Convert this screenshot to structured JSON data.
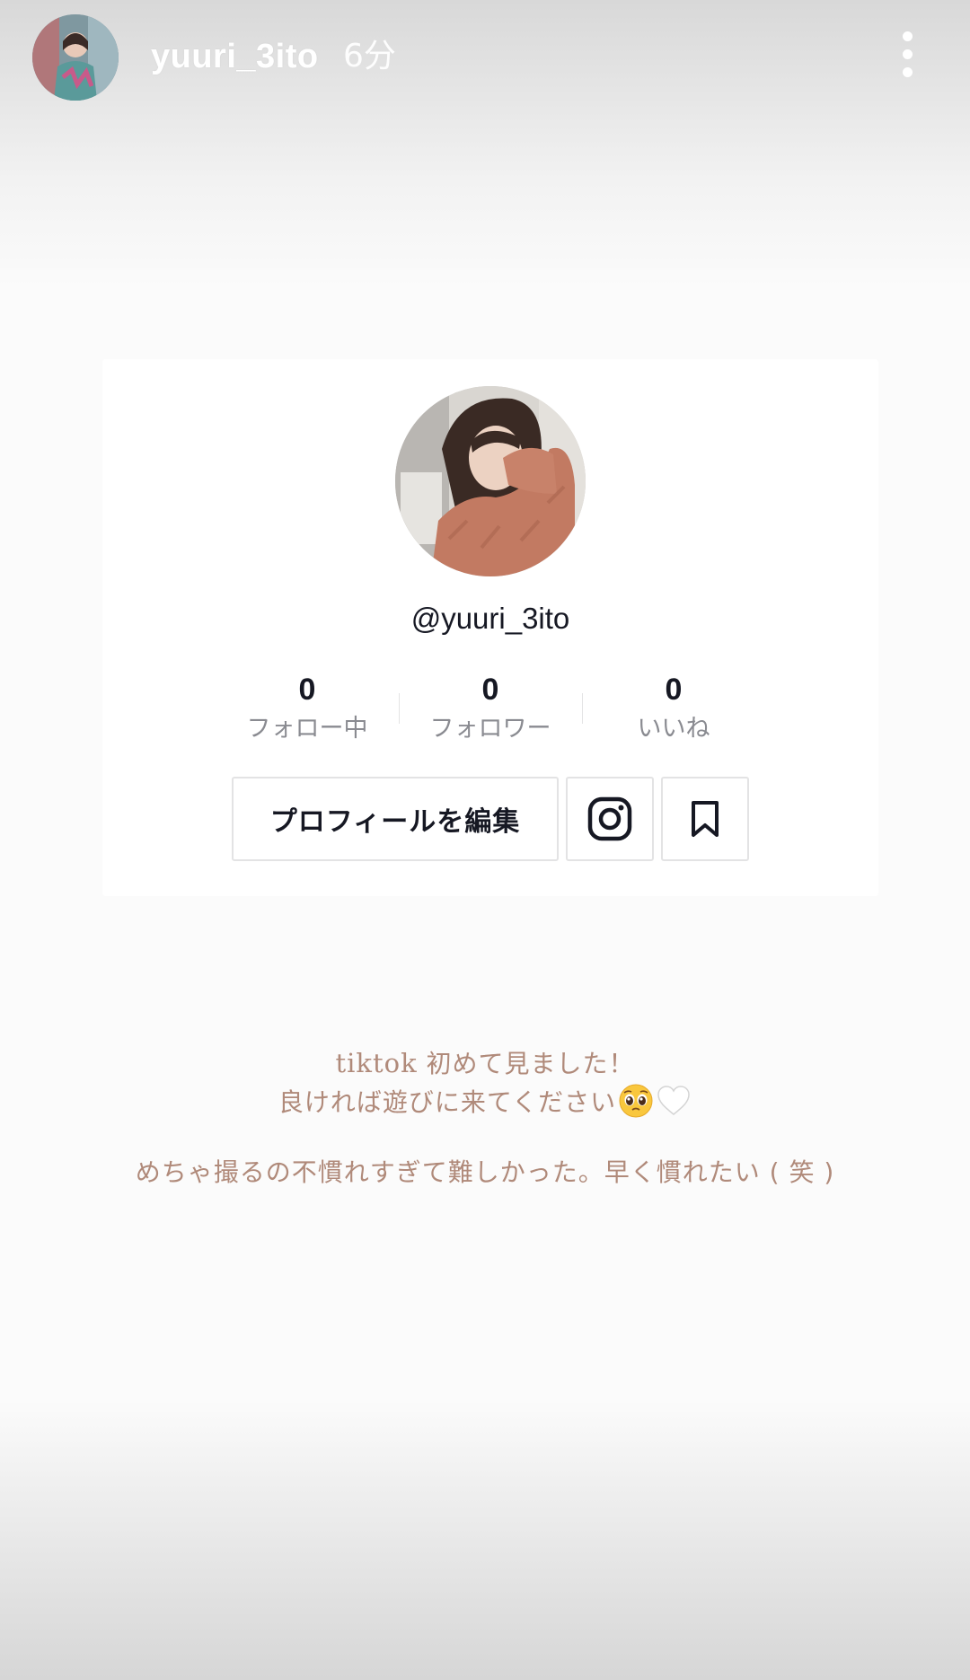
{
  "story": {
    "username": "yuuri_3ito",
    "time": "6分"
  },
  "profile": {
    "handle": "@yuuri_3ito",
    "stats": [
      {
        "value": "0",
        "label": "フォロー中"
      },
      {
        "value": "0",
        "label": "フォロワー"
      },
      {
        "value": "0",
        "label": "いいね"
      }
    ],
    "edit_button_label": "プロフィールを編集"
  },
  "caption": {
    "line1_latin": "tiktok",
    "line1_rest": " 初めて見ました！",
    "line2": "良ければ遊びに来てください",
    "line3": "めちゃ撮るの不慣れすぎて難しかった。早く慣れたい ( 笑 )"
  },
  "icons": {
    "more": "more-vertical-icon",
    "instagram": "instagram-icon",
    "bookmark": "bookmark-icon",
    "emoji_pleading": "pleading-face-emoji",
    "emoji_heart": "white-heart-emoji"
  },
  "colors": {
    "caption_text": "#b08a7a",
    "card_border": "#e3e3e4",
    "primary_text": "#161823",
    "secondary_text": "#8a8b91"
  }
}
